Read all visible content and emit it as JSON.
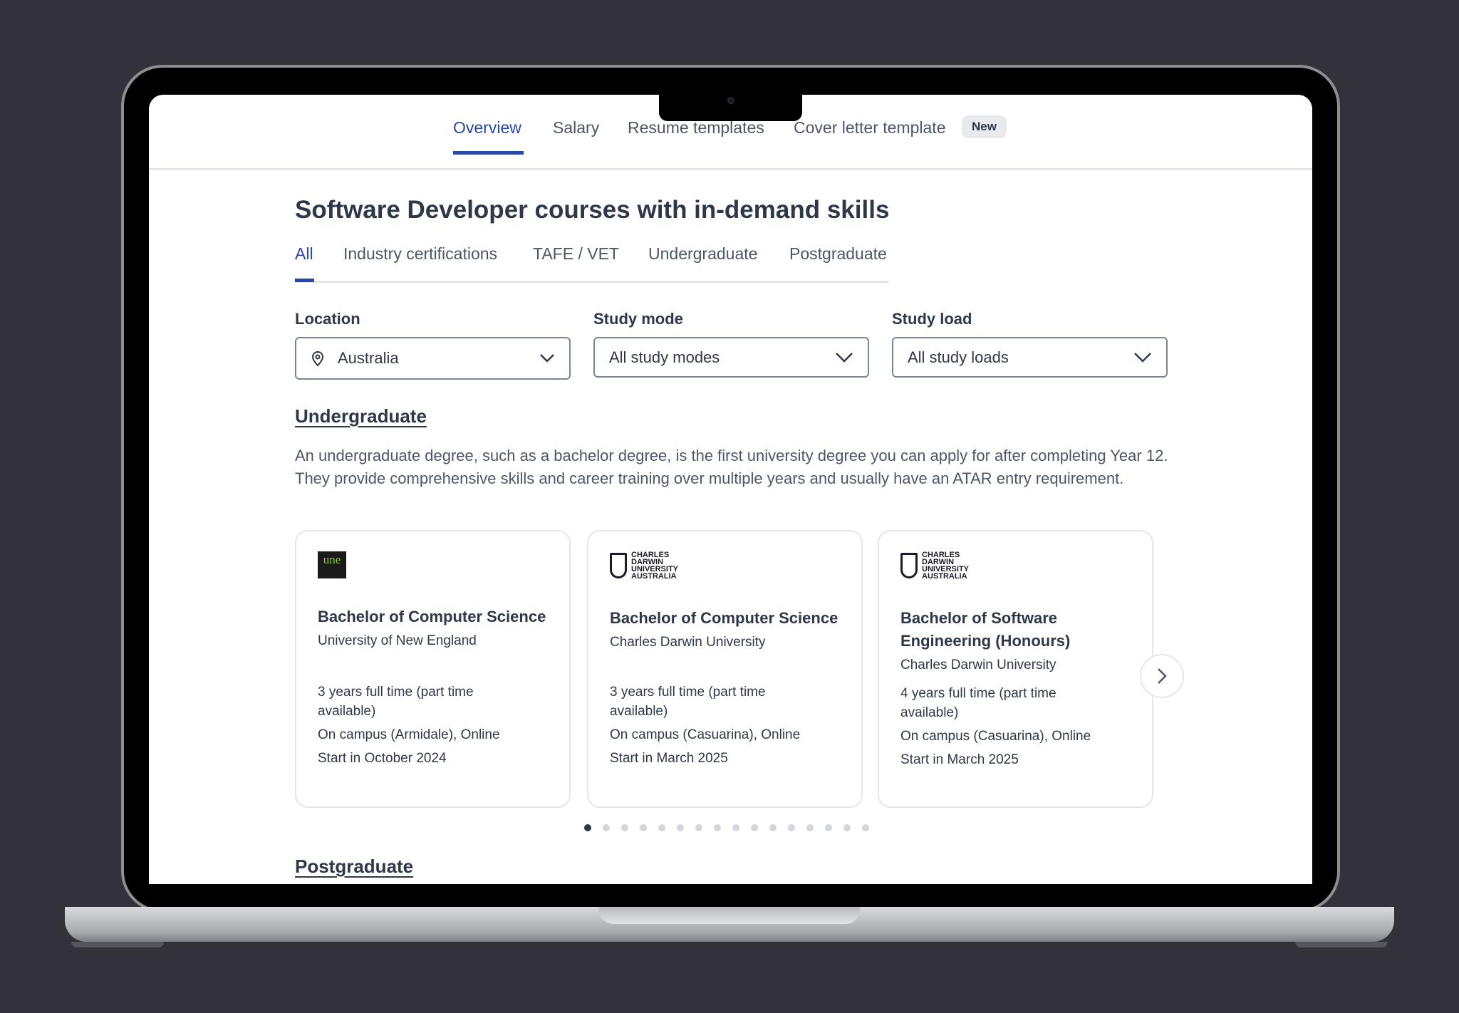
{
  "nav": {
    "tabs": [
      {
        "label": "Overview",
        "active": true
      },
      {
        "label": "Salary"
      },
      {
        "label": "Resume templates"
      },
      {
        "label": "Cover letter template"
      }
    ],
    "badge": "New"
  },
  "page_title": "Software Developer courses with in-demand skills",
  "subtabs": [
    {
      "label": "All",
      "active": true
    },
    {
      "label": "Industry certifications"
    },
    {
      "label": "TAFE / VET"
    },
    {
      "label": "Undergraduate"
    },
    {
      "label": "Postgraduate"
    }
  ],
  "filters": {
    "location": {
      "label": "Location",
      "value": "Australia",
      "icon": "map-pin-icon"
    },
    "study_mode": {
      "label": "Study mode",
      "value": "All study modes"
    },
    "study_load": {
      "label": "Study load",
      "value": "All study loads"
    }
  },
  "undergraduate": {
    "heading": "Undergraduate",
    "description": "An undergraduate degree, such as a bachelor degree, is the first university degree you can apply for after completing Year 12. They provide comprehensive skills and career training over multiple years and usually have an ATAR entry requirement.",
    "cards": [
      {
        "logo": "une",
        "logo_text": "une",
        "title": "Bachelor of Computer Science",
        "university": "University of New England",
        "duration": "3 years full time (part time available)",
        "campus": "On campus (Armidale), Online",
        "start": "Start in October 2024"
      },
      {
        "logo": "cdu",
        "logo_text": "CHARLES DARWIN UNIVERSITY AUSTRALIA",
        "title": "Bachelor of Computer Science",
        "university": "Charles Darwin University",
        "duration": "3 years full time (part time available)",
        "campus": "On campus (Casuarina), Online",
        "start": "Start in March 2025"
      },
      {
        "logo": "cdu",
        "logo_text": "CHARLES DARWIN UNIVERSITY AUSTRALIA",
        "title": "Bachelor of Software Engineering (Honours)",
        "university": "Charles Darwin University",
        "duration": "4 years full time (part time available)",
        "campus": "On campus (Casuarina), Online",
        "start": "Start in March 2025"
      }
    ],
    "carousel": {
      "pages": 16,
      "current": 1
    }
  },
  "postgraduate": {
    "heading": "Postgraduate"
  },
  "colors": {
    "accent": "#2847a8",
    "text": "#2e3849",
    "background": "#33323a"
  }
}
